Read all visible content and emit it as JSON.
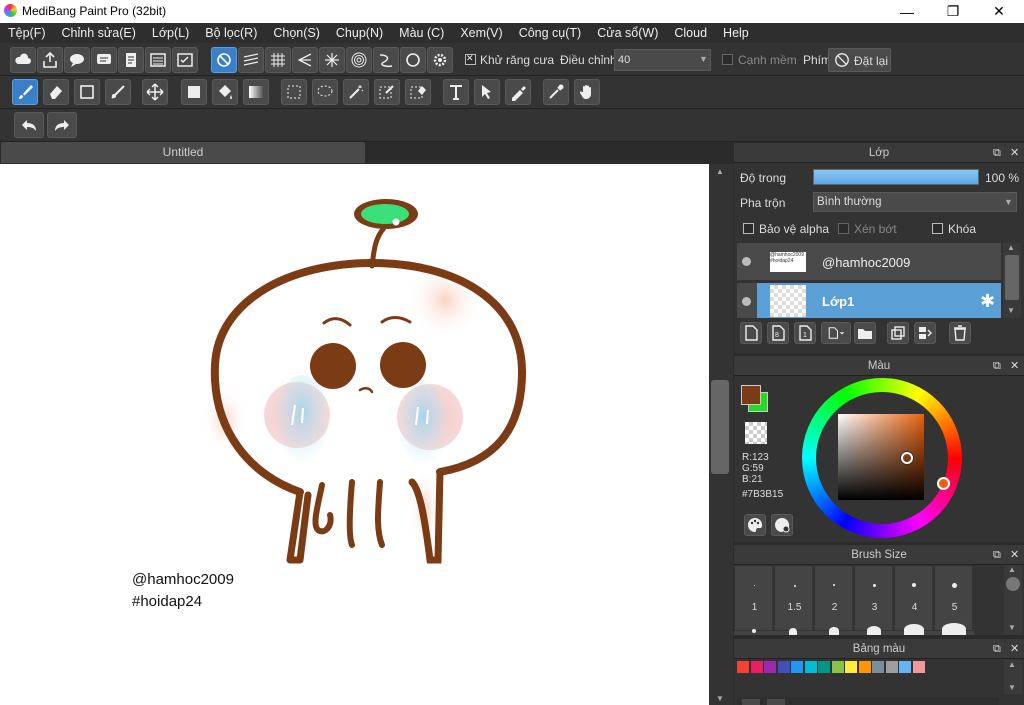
{
  "window": {
    "title": "MediBang Paint Pro (32bit)",
    "min": "—",
    "max": "❐",
    "close": "✕"
  },
  "menu": [
    "Tệp(F)",
    "Chỉnh sửa(E)",
    "Lớp(L)",
    "Bộ lọc(R)",
    "Chọn(S)",
    "Chụp(N)",
    "Màu (C)",
    "Xem(V)",
    "Công cụ(T)",
    "Cửa sổ(W)",
    "Cloud",
    "Help"
  ],
  "toolbar1": {
    "antialias_label": "Khử răng cưa",
    "adjust_label": "Điều chỉnh",
    "adjust_value": "40",
    "soft_edge_label": "Cạnh mềm",
    "key_label": "Phím",
    "reset_label": "Đặt lại"
  },
  "document": {
    "tab": "Untitled"
  },
  "canvas_text": {
    "line1": "@hamhoc2009",
    "line2": "#hoidap24"
  },
  "layer_panel": {
    "title": "Lớp",
    "opacity_label": "Độ trong",
    "opacity_value": "100 %",
    "opacity_fraction": 1.0,
    "blend_label": "Pha trộn",
    "blend_value": "Bình thường",
    "protect_alpha": "Bảo vệ alpha",
    "clip": "Xén bớt",
    "lock": "Khóa",
    "layers": [
      {
        "name": "@hamhoc2009",
        "selected": false
      },
      {
        "name": "Lớp1",
        "selected": true
      }
    ]
  },
  "color_panel": {
    "title": "Màu",
    "r": "R:123",
    "g": "G:59",
    "b": "B:21",
    "hex": "#7B3B15",
    "fg_color": "#7B3B15",
    "bg_color": "#22dd22"
  },
  "brush_panel": {
    "title": "Brush Size",
    "sizes": [
      "1",
      "1.5",
      "2",
      "3",
      "4",
      "5"
    ]
  },
  "palette_panel": {
    "title": "Bảng màu",
    "colors": [
      "#f44336",
      "#e91e63",
      "#9c27b0",
      "#3f51b5",
      "#2196f3",
      "#00bcd4",
      "#009688",
      "#8bc34a",
      "#ffeb3b",
      "#ff9800",
      "#78909c",
      "#9e9e9e",
      "#64b5f6",
      "#ef9a9a"
    ]
  },
  "accent_color": "#3a7fc8"
}
